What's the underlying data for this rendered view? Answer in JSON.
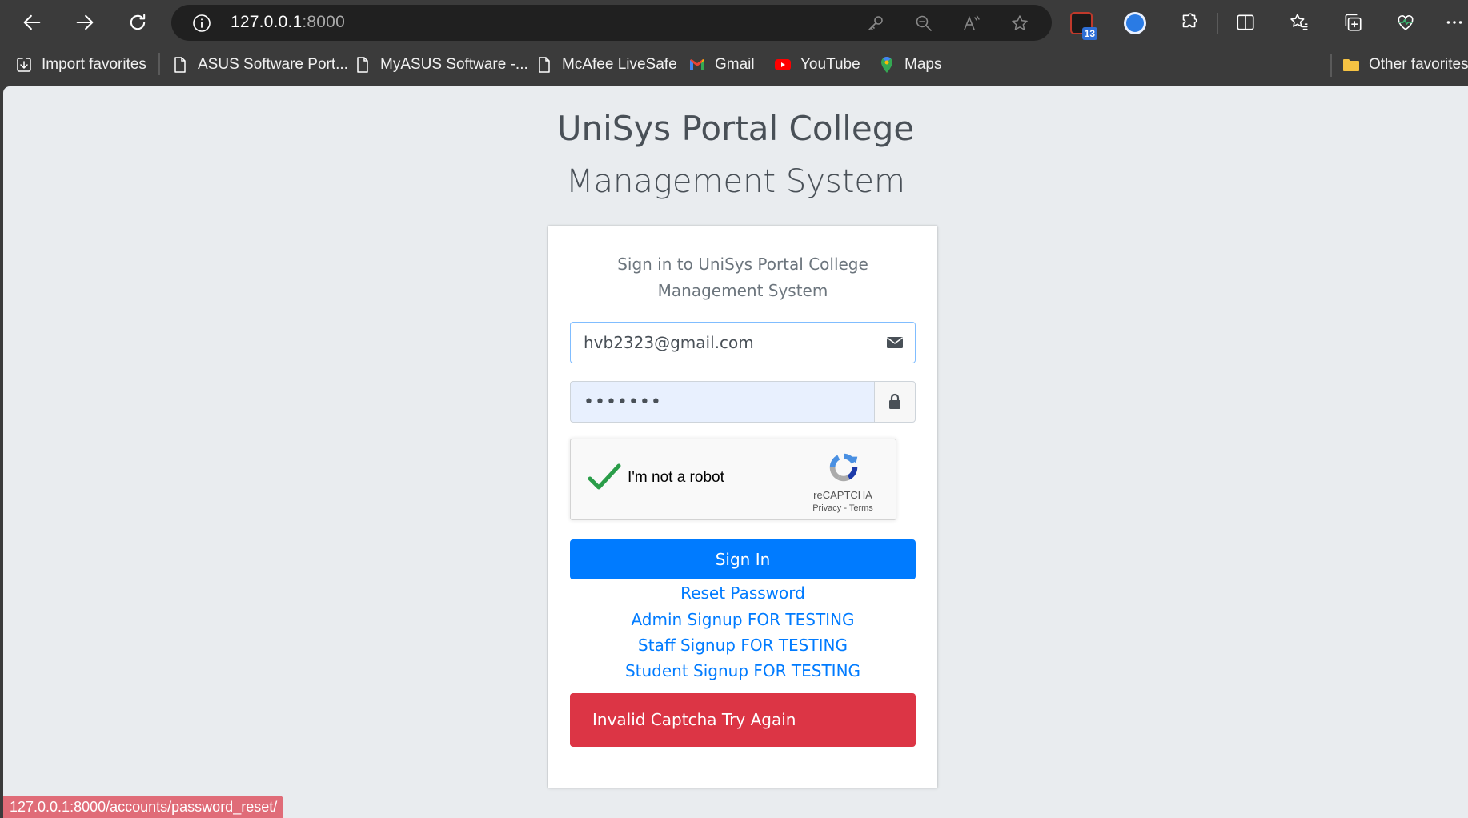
{
  "browser": {
    "url_host": "127.0.0.1",
    "url_port": ":8000",
    "favorites": [
      {
        "label": "Import favorites",
        "icon": "import-icon"
      },
      {
        "label": "ASUS Software Port...",
        "icon": "page-icon"
      },
      {
        "label": "MyASUS Software -...",
        "icon": "page-icon"
      },
      {
        "label": "McAfee LiveSafe",
        "icon": "page-icon"
      },
      {
        "label": "Gmail",
        "icon": "gmail-icon"
      },
      {
        "label": "YouTube",
        "icon": "youtube-icon"
      },
      {
        "label": "Maps",
        "icon": "maps-icon"
      }
    ],
    "other_favorites": "Other favorites",
    "extension_badge_count": "13"
  },
  "page": {
    "brand_line1": "UniSys Portal College",
    "brand_line2": "Management System",
    "login_msg_line1": "Sign in to UniSys Portal College",
    "login_msg_line2": "Management System",
    "email_value": "hvb2323@gmail.com",
    "password_value": "•••••••",
    "recaptcha": {
      "label": "I'm not a robot",
      "brand": "reCAPTCHA",
      "terms": "Privacy - Terms",
      "checked": true
    },
    "sign_in": "Sign In",
    "links": [
      "Reset Password",
      "Admin Signup FOR TESTING",
      "Staff Signup FOR TESTING",
      "Student Signup FOR TESTING"
    ],
    "alert": "Invalid Captcha Try Again",
    "colors": {
      "primary": "#007bff",
      "danger": "#dc3545",
      "page_bg": "#e9ecef"
    }
  },
  "status_bar": "127.0.0.1:8000/accounts/password_reset/"
}
